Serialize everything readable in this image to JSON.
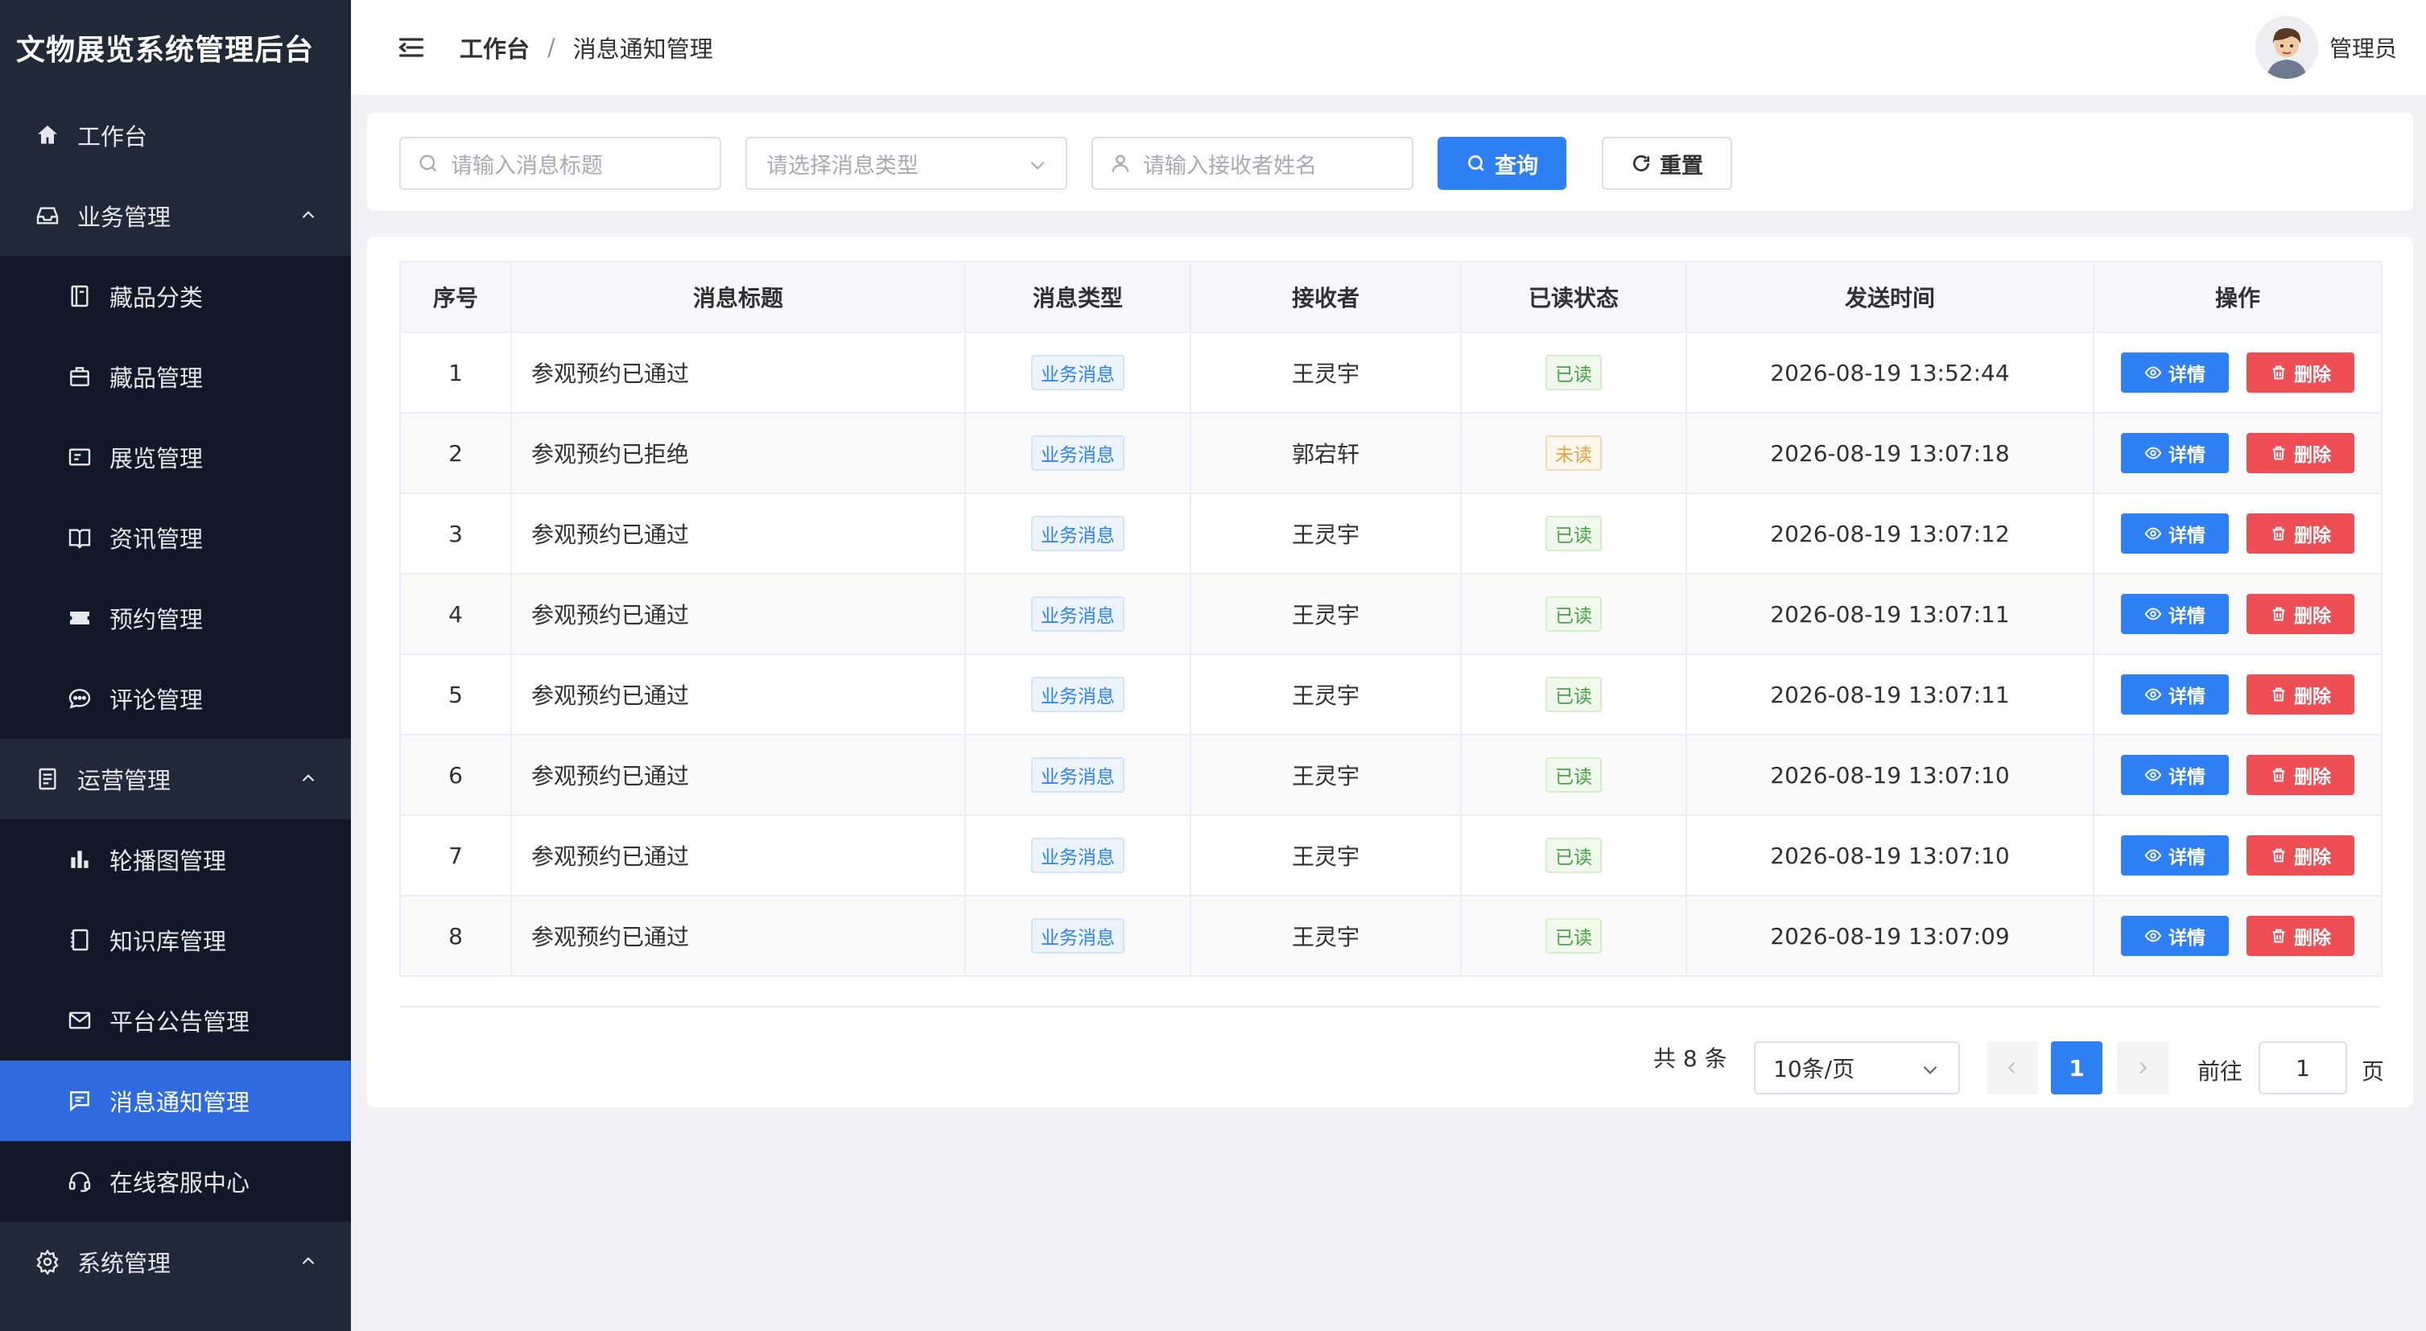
{
  "app": {
    "title": "文物展览系统管理后台"
  },
  "sidebar": {
    "items": [
      {
        "label": "工作台",
        "icon": "home-icon",
        "level": "top"
      },
      {
        "label": "业务管理",
        "icon": "inbox-icon",
        "level": "top",
        "expanded": true
      },
      {
        "label": "藏品分类",
        "icon": "notebook-icon",
        "level": "sub"
      },
      {
        "label": "藏品管理",
        "icon": "suitcase-icon",
        "level": "sub"
      },
      {
        "label": "展览管理",
        "icon": "postcard-icon",
        "level": "sub"
      },
      {
        "label": "资讯管理",
        "icon": "book-icon",
        "level": "sub"
      },
      {
        "label": "预约管理",
        "icon": "ticket-icon",
        "level": "sub"
      },
      {
        "label": "评论管理",
        "icon": "chat-dots-icon",
        "level": "sub"
      },
      {
        "label": "运营管理",
        "icon": "document-icon",
        "level": "top",
        "expanded": true
      },
      {
        "label": "轮播图管理",
        "icon": "histogram-icon",
        "level": "sub"
      },
      {
        "label": "知识库管理",
        "icon": "reading-icon",
        "level": "sub"
      },
      {
        "label": "平台公告管理",
        "icon": "message-icon",
        "level": "sub"
      },
      {
        "label": "消息通知管理",
        "icon": "chat-square-icon",
        "level": "sub",
        "active": true
      },
      {
        "label": "在线客服中心",
        "icon": "headset-icon",
        "level": "sub"
      },
      {
        "label": "系统管理",
        "icon": "setting-icon",
        "level": "top",
        "expanded": true
      }
    ]
  },
  "header": {
    "breadcrumb_home": "工作台",
    "breadcrumb_sep": "/",
    "breadcrumb_current": "消息通知管理",
    "user_name": "管理员"
  },
  "filters": {
    "title_placeholder": "请输入消息标题",
    "type_placeholder": "请选择消息类型",
    "receiver_placeholder": "请输入接收者姓名",
    "query_label": "查询",
    "reset_label": "重置"
  },
  "table": {
    "columns": [
      "序号",
      "消息标题",
      "消息类型",
      "接收者",
      "已读状态",
      "发送时间",
      "操作"
    ],
    "detail_label": "详情",
    "delete_label": "删除",
    "rows": [
      {
        "index": "1",
        "title": "参观预约已通过",
        "type": "业务消息",
        "receiver": "王灵宇",
        "status": "已读",
        "status_kind": "read",
        "time": "2026-08-19 13:52:44"
      },
      {
        "index": "2",
        "title": "参观预约已拒绝",
        "type": "业务消息",
        "receiver": "郭宕轩",
        "status": "未读",
        "status_kind": "unread",
        "time": "2026-08-19 13:07:18"
      },
      {
        "index": "3",
        "title": "参观预约已通过",
        "type": "业务消息",
        "receiver": "王灵宇",
        "status": "已读",
        "status_kind": "read",
        "time": "2026-08-19 13:07:12"
      },
      {
        "index": "4",
        "title": "参观预约已通过",
        "type": "业务消息",
        "receiver": "王灵宇",
        "status": "已读",
        "status_kind": "read",
        "time": "2026-08-19 13:07:11"
      },
      {
        "index": "5",
        "title": "参观预约已通过",
        "type": "业务消息",
        "receiver": "王灵宇",
        "status": "已读",
        "status_kind": "read",
        "time": "2026-08-19 13:07:11"
      },
      {
        "index": "6",
        "title": "参观预约已通过",
        "type": "业务消息",
        "receiver": "王灵宇",
        "status": "已读",
        "status_kind": "read",
        "time": "2026-08-19 13:07:10"
      },
      {
        "index": "7",
        "title": "参观预约已通过",
        "type": "业务消息",
        "receiver": "王灵宇",
        "status": "已读",
        "status_kind": "read",
        "time": "2026-08-19 13:07:10"
      },
      {
        "index": "8",
        "title": "参观预约已通过",
        "type": "业务消息",
        "receiver": "王灵宇",
        "status": "已读",
        "status_kind": "read",
        "time": "2026-08-19 13:07:09"
      }
    ]
  },
  "pagination": {
    "total_text": "共 8 条",
    "page_size": "10条/页",
    "current_page": "1",
    "goto_label": "前往",
    "goto_value": "1",
    "goto_suffix": "页"
  },
  "colors": {
    "sidebar_bg": "#1f2937",
    "active_menu": "#2f6bde",
    "primary": "#2f80f5",
    "danger": "#ee4f55"
  }
}
